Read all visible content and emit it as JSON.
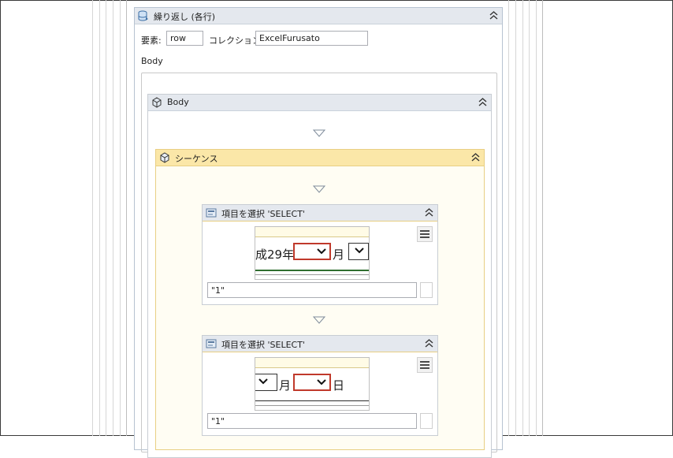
{
  "foreach": {
    "title": "繰り返し (各行)",
    "item_label": "要素:",
    "item_value": "row",
    "collection_label": "コレクション:",
    "collection_value": "ExcelFurusato",
    "body_label": "Body"
  },
  "body_activity": {
    "title": "Body"
  },
  "sequence": {
    "title": "シーケンス"
  },
  "select_items": [
    {
      "title": "項目を選択 'SELECT'",
      "screenshot_text_1": "成29年",
      "screenshot_text_2": "月",
      "value": "\"1\""
    },
    {
      "title": "項目を選択 'SELECT'",
      "screenshot_text_1": "月",
      "screenshot_text_2": "日",
      "value": "\"1\""
    }
  ],
  "icons": {
    "foreach": "database-loop-icon",
    "body": "activity-cube-icon",
    "sequence": "sequence-icon",
    "select_item": "select-item-icon",
    "collapse": "chevron-double-up-icon",
    "drop": "drop-arrow-icon",
    "menu": "hamburger-menu-icon"
  },
  "colors": {
    "header_gray": "#e4e8ee",
    "sequence_yellow": "#fbe7a8",
    "highlight_red": "#c0392b"
  }
}
